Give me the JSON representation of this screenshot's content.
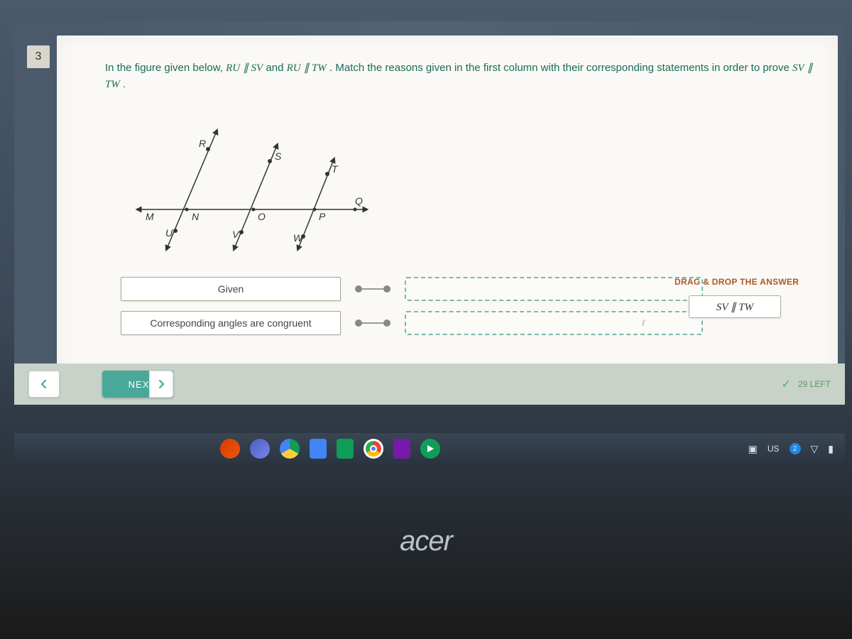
{
  "question": {
    "number": "3",
    "prefix": "In the figure given below, ",
    "cond1": "RU",
    "parallel": " ∥ ",
    "cond2": "SV",
    "and": " and ",
    "cond3": "RU",
    "cond4": "TW",
    "suffix": ". Match the reasons given in the first column with their corresponding statements in order to prove ",
    "prove1": "SV",
    "prove2": "TW",
    "end": "."
  },
  "figure": {
    "points": [
      "R",
      "S",
      "T",
      "M",
      "N",
      "O",
      "P",
      "Q",
      "U",
      "V",
      "W"
    ]
  },
  "matching": {
    "reasons": [
      "Given",
      "Corresponding angles are congruent"
    ]
  },
  "answer_panel": {
    "title": "DRAG & DROP THE ANSWER",
    "chip": "SV ∥ TW"
  },
  "nav": {
    "next": "NEXT",
    "remaining": "29 LEFT"
  },
  "taskbar": {
    "lang": "US",
    "notif": "2"
  },
  "brand": "acer"
}
